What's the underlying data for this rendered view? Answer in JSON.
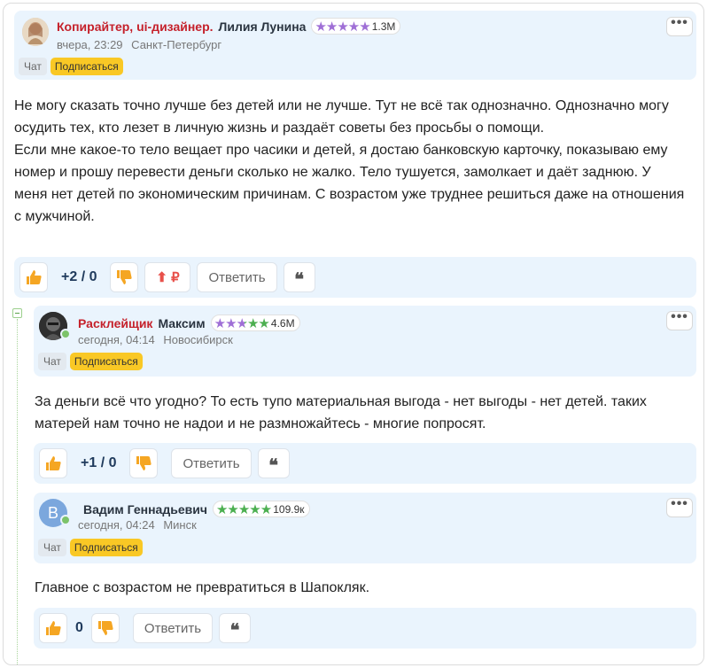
{
  "colors": {
    "header_bg": "#eaf4fd",
    "rank_red": "#c5212b",
    "subscribe_yellow": "#f9c825",
    "star_purple": "#9f6fd6",
    "star_green": "#4caf50",
    "thumb_orange": "#f5a623"
  },
  "comments": [
    {
      "rank": "Копирайтер, ui-дизайнер.",
      "name": "Лилия Лунина",
      "stars_icon": "★★★★★",
      "followers": "1.3M",
      "time": "вчера, 23:29",
      "city": "Санкт-Петербург",
      "chat_label": "Чат",
      "subscribe_label": "Подписаться",
      "menu_label": "•••",
      "text": "Не могу сказать точно лучше без детей или не лучше. Тут не всё так однозначно. Однозначно могу осудить тех, кто лезет в личную жизнь и раздаёт советы без просьбы о помощи.\nЕсли мне какое-то тело вещает про часики и детей, я достаю банковскую карточку, показываю ему номер и прошу перевести деньги сколько не жалко. Тело тушуется, замолкает и даёт заднюю. У меня нет детей по экономическим причинам. С возрастом уже труднее решиться даже на отношения с мужчиной.",
      "score": "+2 / 0",
      "tip_label": "⬆ ₽",
      "reply_label": "Ответить",
      "quote_label": "❝",
      "avatar_icon": "user-photo-icon"
    },
    {
      "rank": "Расклейщик",
      "name": "Максим",
      "stars_icon": "★★★★★",
      "followers": "4.6M",
      "time": "сегодня, 04:14",
      "city": "Новосибирск",
      "chat_label": "Чат",
      "subscribe_label": "Подписаться",
      "menu_label": "•••",
      "text": "За деньги всё что угодно? То есть тупо материальная выгода - нет выгоды - нет детей. таких матерей нам точно не надои и не размножайтесь - многие попросят.",
      "score": "+1 / 0",
      "reply_label": "Ответить",
      "quote_label": "❝",
      "avatar_icon": "user-photo-icon"
    },
    {
      "rank": "",
      "name": "Вадим Геннадьевич",
      "avatar_letter": "В",
      "stars_icon": "★★★★★",
      "followers": "109.9к",
      "time": "сегодня, 04:24",
      "city": "Минск",
      "chat_label": "Чат",
      "subscribe_label": "Подписаться",
      "menu_label": "•••",
      "text": "Главное с возрастом не превратиться в Шапокляк.",
      "score": "0",
      "reply_label": "Ответить",
      "quote_label": "❝"
    }
  ]
}
